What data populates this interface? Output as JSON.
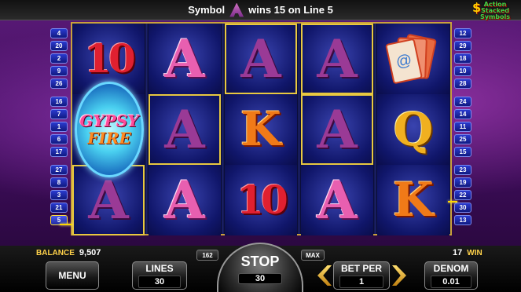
{
  "message": {
    "prefix": "Symbol",
    "suffix": "wins 15 on Line 5"
  },
  "logo": {
    "line1": "Action",
    "line2": "Stacked",
    "line3": "Symbols",
    "dollar": "$"
  },
  "left_lines": [
    "4",
    "20",
    "2",
    "9",
    "26",
    "16",
    "7",
    "1",
    "6",
    "17",
    "27",
    "8",
    "3",
    "21",
    "5"
  ],
  "right_lines": [
    "12",
    "29",
    "18",
    "10",
    "28",
    "24",
    "14",
    "11",
    "25",
    "15",
    "23",
    "19",
    "22",
    "30",
    "13"
  ],
  "reels": [
    [
      "10",
      "GYPSY FIRE",
      "A"
    ],
    [
      "A",
      "A",
      "A"
    ],
    [
      "A",
      "K",
      "10"
    ],
    [
      "A",
      "A",
      "A"
    ],
    [
      "CARDS",
      "Q",
      "K"
    ]
  ],
  "gypsy": {
    "l1": "GYPSY",
    "l2": "FIRE"
  },
  "balance": {
    "label": "BALANCE",
    "value": "9,507"
  },
  "win": {
    "value": "17",
    "label": "WIN"
  },
  "menu_label": "MENU",
  "lines": {
    "label": "LINES",
    "value": "30"
  },
  "btn_162": "162",
  "btn_max": "MAX",
  "stop": {
    "label": "STOP",
    "value": "30"
  },
  "bet_per": {
    "label": "BET PER",
    "value": "1"
  },
  "denom": {
    "label": "DENOM",
    "value": "0.01"
  },
  "colors": {
    "highlight": "#ffd700",
    "reel_bg": "#0b0f44",
    "accent": "#ffd24a"
  }
}
